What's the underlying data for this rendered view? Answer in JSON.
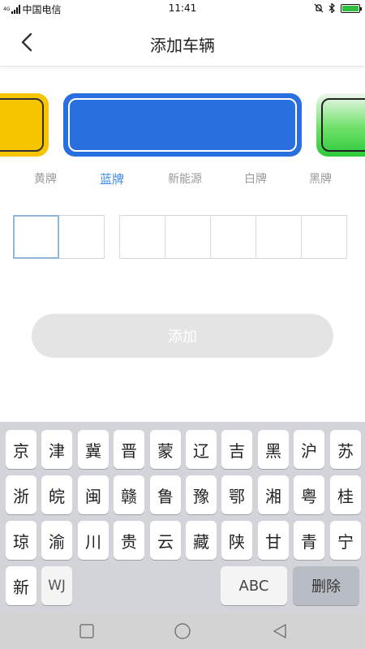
{
  "status_bar": {
    "carrier_tag": "4G",
    "carrier": "中国电信",
    "time": "11:41"
  },
  "nav": {
    "title": "添加车辆",
    "back_icon": "chevron-left-icon"
  },
  "plate_types": [
    {
      "label": "黄牌",
      "color": "#f6c500",
      "active": false
    },
    {
      "label": "蓝牌",
      "color": "#2a6fe0",
      "active": true
    },
    {
      "label": "新能源",
      "color": "#2dc93a",
      "active": false
    },
    {
      "label": "白牌",
      "color": "#ffffff",
      "active": false
    },
    {
      "label": "黑牌",
      "color": "#000000",
      "active": false
    }
  ],
  "plate_input": {
    "values": [
      "",
      "",
      "",
      "",
      "",
      "",
      ""
    ],
    "focused_index": 0
  },
  "add_button": {
    "label": "添加"
  },
  "keyboard": {
    "rows": [
      [
        "京",
        "津",
        "冀",
        "晋",
        "蒙",
        "辽",
        "吉",
        "黑",
        "沪",
        "苏"
      ],
      [
        "浙",
        "皖",
        "闽",
        "赣",
        "鲁",
        "豫",
        "鄂",
        "湘",
        "粤",
        "桂"
      ],
      [
        "琼",
        "渝",
        "川",
        "贵",
        "云",
        "藏",
        "陕",
        "甘",
        "青",
        "宁"
      ],
      [
        "新",
        "WJ"
      ]
    ],
    "abc_label": "ABC",
    "delete_label": "删除"
  },
  "system_nav": [
    "square-icon",
    "circle-icon",
    "triangle-back-icon"
  ],
  "colors": {
    "accent": "#3b8be8",
    "button_disabled": "#e4e4e4",
    "keyboard_bg": "#d2d4d9"
  }
}
